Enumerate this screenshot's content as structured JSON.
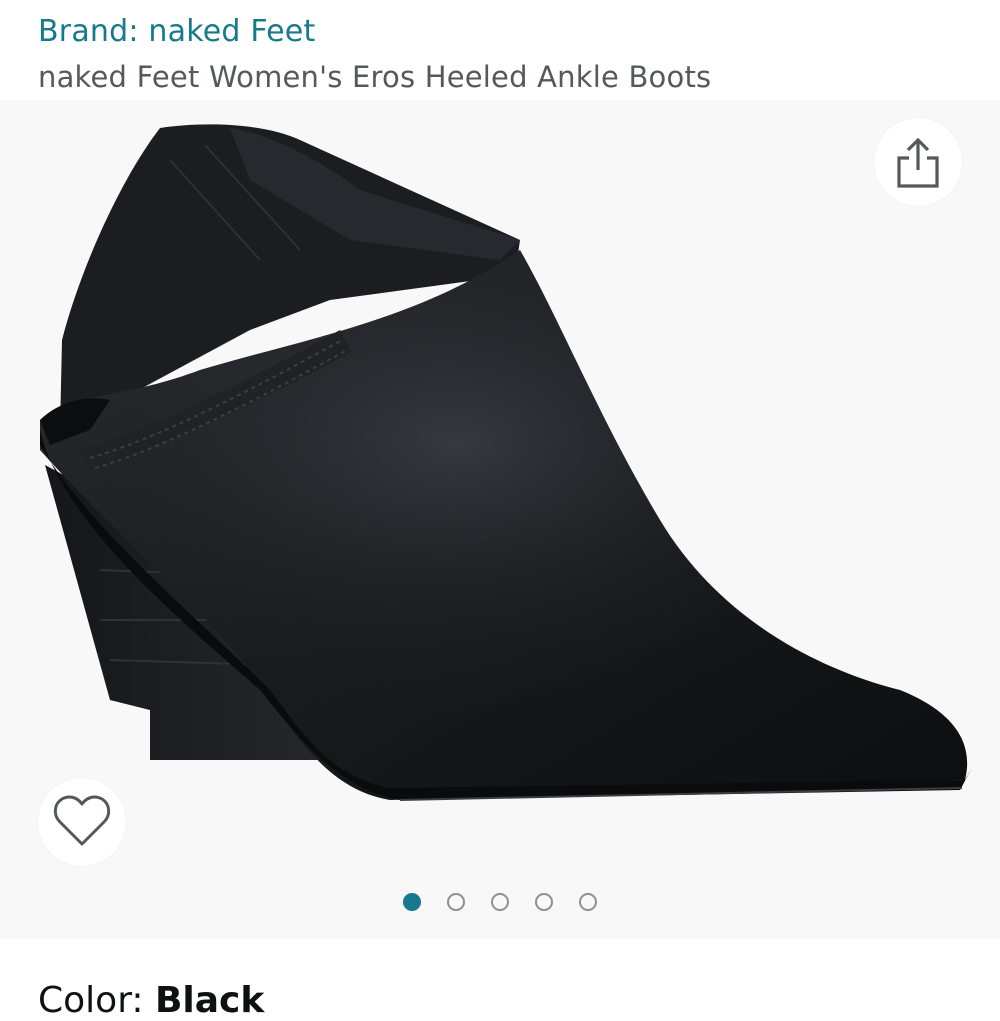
{
  "header": {
    "brand_link": "Brand: naked Feet",
    "product_title": "naked Feet Women's Eros Heeled Ankle Boots"
  },
  "gallery": {
    "image_alt": "Black leather heeled ankle bootie with elastic heel strap",
    "share_icon": "share-icon",
    "wishlist_icon": "heart-icon",
    "page_count": 5,
    "active_page": 1
  },
  "variation": {
    "color_label": "Color: ",
    "color_value": "Black"
  },
  "colors": {
    "link": "#167a8c",
    "title": "#565959",
    "gallery_bg": "#f8f8f8",
    "dot_active": "#167a8c",
    "dot_inactive": "#8a9191"
  }
}
